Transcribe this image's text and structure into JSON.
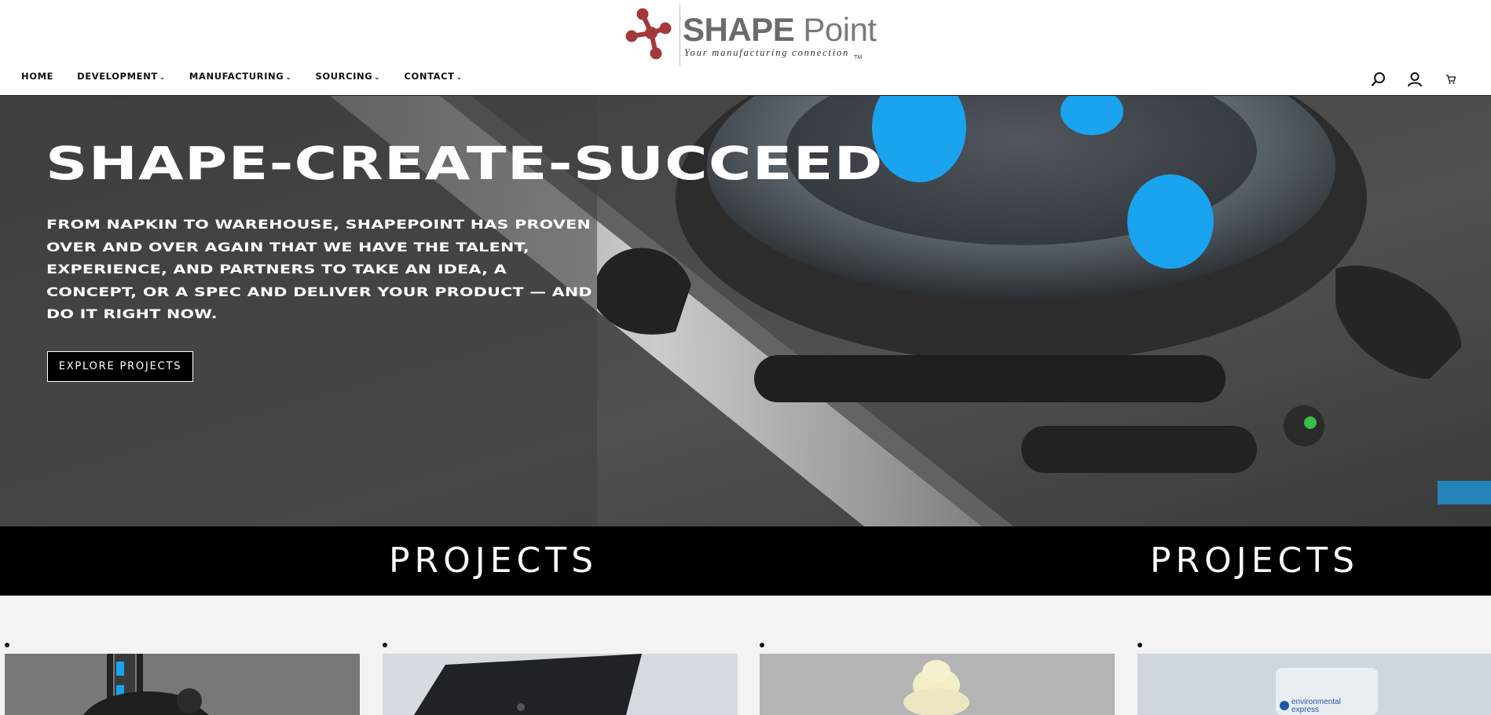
{
  "brand": {
    "name_bold": "SHAPE",
    "name_light": " Point",
    "tagline": "Your manufacturing connection",
    "tm": "TM",
    "color": "#a3383a"
  },
  "nav": {
    "items": [
      {
        "label": "HOME",
        "caret": ""
      },
      {
        "label": "DEVELOPMENT",
        "caret": "⌄"
      },
      {
        "label": "MANUFACTURING",
        "caret": "⌄"
      },
      {
        "label": "SOURCING",
        "caret": "⌄"
      },
      {
        "label": "CONTACT",
        "caret": "⌄"
      }
    ],
    "icons": [
      "search-icon",
      "account-icon",
      "cart-icon"
    ]
  },
  "hero": {
    "title": "SHAPE-CREATE-SUCCEED",
    "body": "FROM NAPKIN TO WAREHOUSE, SHAPEPOINT HAS PROVEN OVER AND OVER AGAIN THAT WE HAVE THE TALENT, EXPERIENCE, AND PARTNERS TO TAKE AN IDEA, A CONCEPT, OR A SPEC AND DELIVER YOUR PRODUCT — AND DO IT RIGHT NOW.",
    "button": "EXPLORE PROJECTS",
    "accent": "#1aa3ef"
  },
  "band": {
    "items": [
      "PROJECTS",
      "PROJECTS"
    ]
  },
  "projects": {
    "cards": [
      {
        "image": "fitness-machine-image"
      },
      {
        "image": "dark-panel-image"
      },
      {
        "image": "ice-cream-cone-image"
      },
      {
        "image": "environmental-express-container-image",
        "label": "environmental express"
      }
    ]
  }
}
